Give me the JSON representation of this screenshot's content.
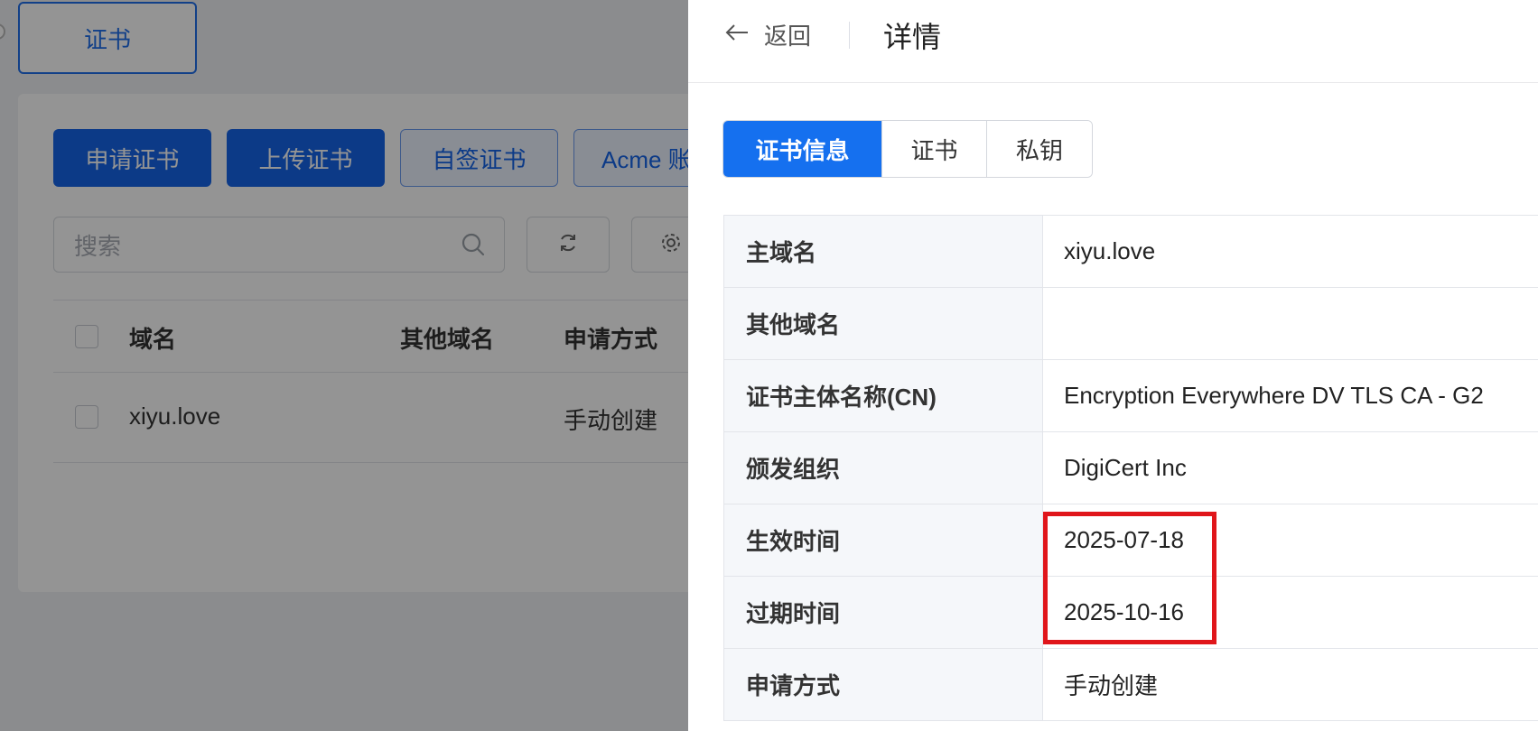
{
  "background": {
    "top_tab_label": "证书",
    "actions": {
      "apply": "申请证书",
      "upload": "上传证书",
      "self_sign": "自签证书",
      "acme": "Acme 账户"
    },
    "search_placeholder": "搜索",
    "table": {
      "headers": {
        "domain": "域名",
        "other_domains": "其他域名",
        "method": "申请方式"
      },
      "rows": [
        {
          "domain": "xiyu.love",
          "other_domains": "",
          "method": "手动创建"
        }
      ]
    }
  },
  "drawer": {
    "back_label": "返回",
    "title": "详情",
    "tabs": [
      "证书信息",
      "证书",
      "私钥"
    ],
    "active_tab": "证书信息",
    "details": [
      {
        "label": "主域名",
        "value": "xiyu.love"
      },
      {
        "label": "其他域名",
        "value": ""
      },
      {
        "label": "证书主体名称(CN)",
        "value": "Encryption Everywhere DV TLS CA - G2"
      },
      {
        "label": "颁发组织",
        "value": "DigiCert Inc"
      },
      {
        "label": "生效时间",
        "value": "2025-07-18"
      },
      {
        "label": "过期时间",
        "value": "2025-10-16"
      },
      {
        "label": "申请方式",
        "value": "手动创建"
      }
    ],
    "highlight_color": "#e0161b"
  },
  "colors": {
    "primary": "#1570ef",
    "overlay": "rgba(0,0,0,0.42)"
  }
}
